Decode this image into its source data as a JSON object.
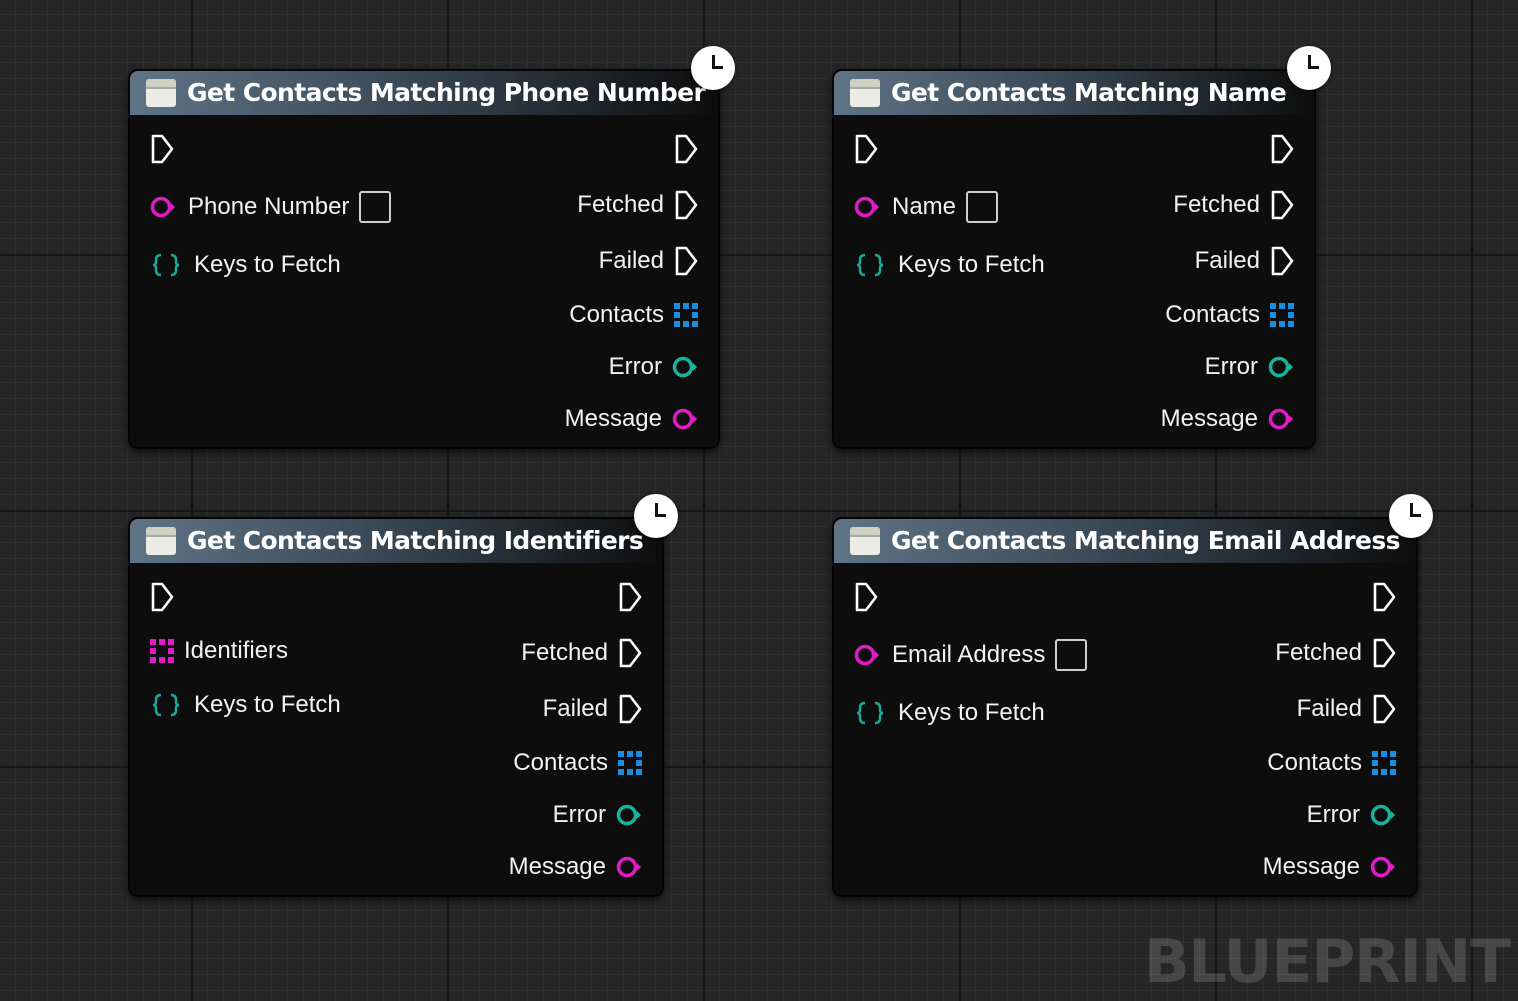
{
  "graph": {
    "watermark": "BLUEPRINT",
    "colors": {
      "grid_background": "#262626",
      "node_header": "#5f7487",
      "exec_pin": "#ffffff",
      "string_pin": "#e01bc7",
      "error_pin": "#16b598",
      "array_pin": "#1a8fe0",
      "identifiers_array_pin": "#e01bc7",
      "struct_pin": "#1aa89a"
    }
  },
  "nodes": [
    {
      "title": "Get Contacts Matching Phone Number",
      "inputs": [
        {
          "label": "Phone Number",
          "type": "string",
          "has_text_box": true
        },
        {
          "label": "Keys to Fetch",
          "type": "struct"
        }
      ],
      "outputs": [
        {
          "label": "Fetched",
          "type": "exec"
        },
        {
          "label": "Failed",
          "type": "exec"
        },
        {
          "label": "Contacts",
          "type": "array"
        },
        {
          "label": "Error",
          "type": "error"
        },
        {
          "label": "Message",
          "type": "string"
        }
      ]
    },
    {
      "title": "Get Contacts Matching Name",
      "inputs": [
        {
          "label": "Name",
          "type": "string",
          "has_text_box": true
        },
        {
          "label": "Keys to Fetch",
          "type": "struct"
        }
      ],
      "outputs": [
        {
          "label": "Fetched",
          "type": "exec"
        },
        {
          "label": "Failed",
          "type": "exec"
        },
        {
          "label": "Contacts",
          "type": "array"
        },
        {
          "label": "Error",
          "type": "error"
        },
        {
          "label": "Message",
          "type": "string"
        }
      ]
    },
    {
      "title": "Get Contacts Matching Identifiers",
      "inputs": [
        {
          "label": "Identifiers",
          "type": "string_array"
        },
        {
          "label": "Keys to Fetch",
          "type": "struct"
        }
      ],
      "outputs": [
        {
          "label": "Fetched",
          "type": "exec"
        },
        {
          "label": "Failed",
          "type": "exec"
        },
        {
          "label": "Contacts",
          "type": "array"
        },
        {
          "label": "Error",
          "type": "error"
        },
        {
          "label": "Message",
          "type": "string"
        }
      ]
    },
    {
      "title": "Get Contacts Matching Email Address",
      "inputs": [
        {
          "label": "Email Address",
          "type": "string",
          "has_text_box": true
        },
        {
          "label": "Keys to Fetch",
          "type": "struct"
        }
      ],
      "outputs": [
        {
          "label": "Fetched",
          "type": "exec"
        },
        {
          "label": "Failed",
          "type": "exec"
        },
        {
          "label": "Contacts",
          "type": "array"
        },
        {
          "label": "Error",
          "type": "error"
        },
        {
          "label": "Message",
          "type": "string"
        }
      ]
    }
  ]
}
